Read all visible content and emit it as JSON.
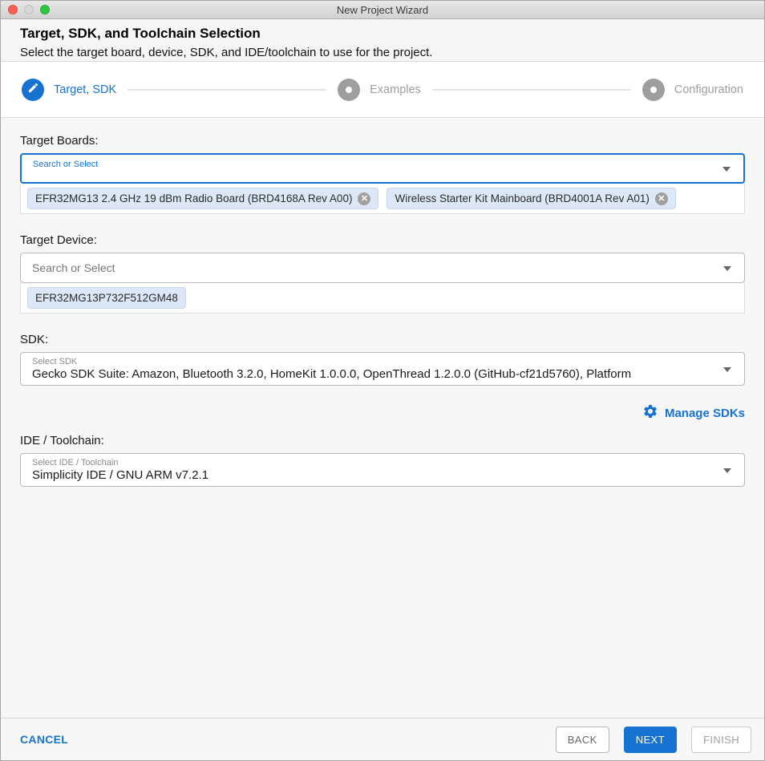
{
  "window": {
    "title": "New Project Wizard"
  },
  "header": {
    "title": "Target, SDK, and Toolchain Selection",
    "subtitle": "Select the target board, device, SDK, and IDE/toolchain to use for the project."
  },
  "stepper": {
    "steps": [
      {
        "label": "Target, SDK",
        "state": "active",
        "icon": "pencil-icon"
      },
      {
        "label": "Examples",
        "state": "inactive",
        "icon": "dot-icon"
      },
      {
        "label": "Configuration",
        "state": "inactive",
        "icon": "dot-icon"
      }
    ]
  },
  "target_boards": {
    "label": "Target Boards:",
    "placeholder": "Search or Select",
    "chips": [
      {
        "label": "EFR32MG13 2.4 GHz 19 dBm Radio Board (BRD4168A Rev A00)",
        "close": "✕"
      },
      {
        "label": "Wireless Starter Kit Mainboard (BRD4001A Rev A01)",
        "close": "✕"
      }
    ]
  },
  "target_device": {
    "label": "Target Device:",
    "placeholder": "Search or Select",
    "chips": [
      {
        "label": "EFR32MG13P732F512GM48"
      }
    ]
  },
  "sdk": {
    "label": "SDK:",
    "select_label": "Select SDK",
    "value": "Gecko SDK Suite: Amazon, Bluetooth 3.2.0, HomeKit 1.0.0.0, OpenThread 1.2.0.0 (GitHub-cf21d5760), Platform",
    "manage_label": "Manage SDKs",
    "manage_icon": "gear-icon"
  },
  "toolchain": {
    "label": "IDE / Toolchain:",
    "select_label": "Select IDE / Toolchain",
    "value": "Simplicity IDE / GNU ARM v7.2.1"
  },
  "footer": {
    "cancel": "CANCEL",
    "back": "BACK",
    "next": "NEXT",
    "finish": "FINISH"
  },
  "colors": {
    "accent_blue": "#1673d2",
    "chip_background": "#dce8f7",
    "inactive_gray": "#9e9e9e",
    "page_background": "#f7f7f7"
  }
}
